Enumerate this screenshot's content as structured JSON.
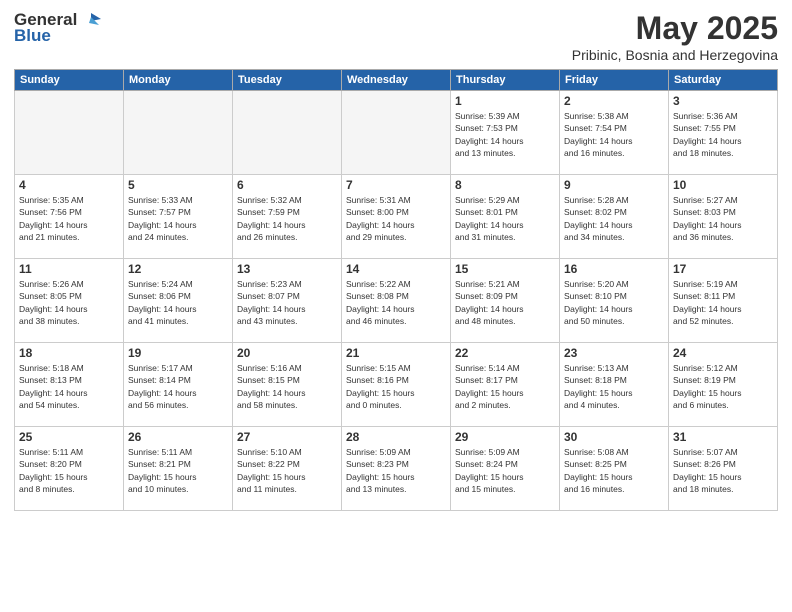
{
  "header": {
    "logo_general": "General",
    "logo_blue": "Blue",
    "month": "May 2025",
    "location": "Pribinic, Bosnia and Herzegovina"
  },
  "weekdays": [
    "Sunday",
    "Monday",
    "Tuesday",
    "Wednesday",
    "Thursday",
    "Friday",
    "Saturday"
  ],
  "weeks": [
    [
      {
        "day": "",
        "info": ""
      },
      {
        "day": "",
        "info": ""
      },
      {
        "day": "",
        "info": ""
      },
      {
        "day": "",
        "info": ""
      },
      {
        "day": "1",
        "info": "Sunrise: 5:39 AM\nSunset: 7:53 PM\nDaylight: 14 hours\nand 13 minutes."
      },
      {
        "day": "2",
        "info": "Sunrise: 5:38 AM\nSunset: 7:54 PM\nDaylight: 14 hours\nand 16 minutes."
      },
      {
        "day": "3",
        "info": "Sunrise: 5:36 AM\nSunset: 7:55 PM\nDaylight: 14 hours\nand 18 minutes."
      }
    ],
    [
      {
        "day": "4",
        "info": "Sunrise: 5:35 AM\nSunset: 7:56 PM\nDaylight: 14 hours\nand 21 minutes."
      },
      {
        "day": "5",
        "info": "Sunrise: 5:33 AM\nSunset: 7:57 PM\nDaylight: 14 hours\nand 24 minutes."
      },
      {
        "day": "6",
        "info": "Sunrise: 5:32 AM\nSunset: 7:59 PM\nDaylight: 14 hours\nand 26 minutes."
      },
      {
        "day": "7",
        "info": "Sunrise: 5:31 AM\nSunset: 8:00 PM\nDaylight: 14 hours\nand 29 minutes."
      },
      {
        "day": "8",
        "info": "Sunrise: 5:29 AM\nSunset: 8:01 PM\nDaylight: 14 hours\nand 31 minutes."
      },
      {
        "day": "9",
        "info": "Sunrise: 5:28 AM\nSunset: 8:02 PM\nDaylight: 14 hours\nand 34 minutes."
      },
      {
        "day": "10",
        "info": "Sunrise: 5:27 AM\nSunset: 8:03 PM\nDaylight: 14 hours\nand 36 minutes."
      }
    ],
    [
      {
        "day": "11",
        "info": "Sunrise: 5:26 AM\nSunset: 8:05 PM\nDaylight: 14 hours\nand 38 minutes."
      },
      {
        "day": "12",
        "info": "Sunrise: 5:24 AM\nSunset: 8:06 PM\nDaylight: 14 hours\nand 41 minutes."
      },
      {
        "day": "13",
        "info": "Sunrise: 5:23 AM\nSunset: 8:07 PM\nDaylight: 14 hours\nand 43 minutes."
      },
      {
        "day": "14",
        "info": "Sunrise: 5:22 AM\nSunset: 8:08 PM\nDaylight: 14 hours\nand 46 minutes."
      },
      {
        "day": "15",
        "info": "Sunrise: 5:21 AM\nSunset: 8:09 PM\nDaylight: 14 hours\nand 48 minutes."
      },
      {
        "day": "16",
        "info": "Sunrise: 5:20 AM\nSunset: 8:10 PM\nDaylight: 14 hours\nand 50 minutes."
      },
      {
        "day": "17",
        "info": "Sunrise: 5:19 AM\nSunset: 8:11 PM\nDaylight: 14 hours\nand 52 minutes."
      }
    ],
    [
      {
        "day": "18",
        "info": "Sunrise: 5:18 AM\nSunset: 8:13 PM\nDaylight: 14 hours\nand 54 minutes."
      },
      {
        "day": "19",
        "info": "Sunrise: 5:17 AM\nSunset: 8:14 PM\nDaylight: 14 hours\nand 56 minutes."
      },
      {
        "day": "20",
        "info": "Sunrise: 5:16 AM\nSunset: 8:15 PM\nDaylight: 14 hours\nand 58 minutes."
      },
      {
        "day": "21",
        "info": "Sunrise: 5:15 AM\nSunset: 8:16 PM\nDaylight: 15 hours\nand 0 minutes."
      },
      {
        "day": "22",
        "info": "Sunrise: 5:14 AM\nSunset: 8:17 PM\nDaylight: 15 hours\nand 2 minutes."
      },
      {
        "day": "23",
        "info": "Sunrise: 5:13 AM\nSunset: 8:18 PM\nDaylight: 15 hours\nand 4 minutes."
      },
      {
        "day": "24",
        "info": "Sunrise: 5:12 AM\nSunset: 8:19 PM\nDaylight: 15 hours\nand 6 minutes."
      }
    ],
    [
      {
        "day": "25",
        "info": "Sunrise: 5:11 AM\nSunset: 8:20 PM\nDaylight: 15 hours\nand 8 minutes."
      },
      {
        "day": "26",
        "info": "Sunrise: 5:11 AM\nSunset: 8:21 PM\nDaylight: 15 hours\nand 10 minutes."
      },
      {
        "day": "27",
        "info": "Sunrise: 5:10 AM\nSunset: 8:22 PM\nDaylight: 15 hours\nand 11 minutes."
      },
      {
        "day": "28",
        "info": "Sunrise: 5:09 AM\nSunset: 8:23 PM\nDaylight: 15 hours\nand 13 minutes."
      },
      {
        "day": "29",
        "info": "Sunrise: 5:09 AM\nSunset: 8:24 PM\nDaylight: 15 hours\nand 15 minutes."
      },
      {
        "day": "30",
        "info": "Sunrise: 5:08 AM\nSunset: 8:25 PM\nDaylight: 15 hours\nand 16 minutes."
      },
      {
        "day": "31",
        "info": "Sunrise: 5:07 AM\nSunset: 8:26 PM\nDaylight: 15 hours\nand 18 minutes."
      }
    ]
  ]
}
